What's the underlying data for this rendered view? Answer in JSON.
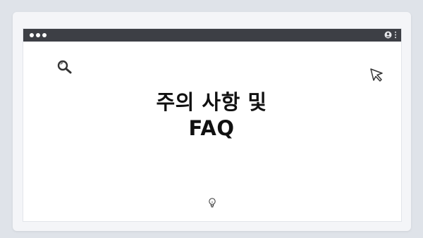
{
  "pager": {
    "count": 4,
    "active": 0
  },
  "window": {
    "titlebar_color": "#3d3f45",
    "traffic_lights": 3,
    "icons": [
      "user-icon",
      "kebab-menu-icon"
    ]
  },
  "content": {
    "title_line1": "주의 사항 및",
    "title_line2": "FAQ"
  },
  "icons": [
    "search-icon",
    "cursor-pointer-icon",
    "lightbulb-icon"
  ]
}
